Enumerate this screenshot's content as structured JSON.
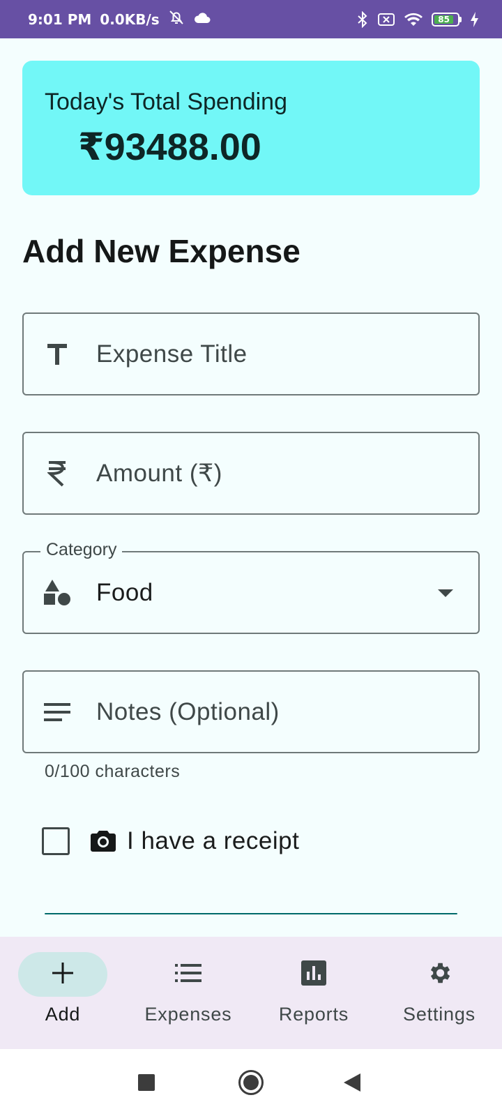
{
  "status_bar": {
    "time": "9:01 PM",
    "network_speed": "0.0KB/s",
    "battery_level": "85",
    "icons": [
      "alarm-off-icon",
      "cloud-icon",
      "bluetooth-icon",
      "no-sim-icon",
      "wifi-icon",
      "battery-icon",
      "charging-icon"
    ]
  },
  "summary": {
    "label": "Today's Total Spending",
    "amount": "₹93488.00"
  },
  "form": {
    "title": "Add New Expense",
    "title_field": {
      "placeholder": "Expense Title",
      "icon": "text-title-icon"
    },
    "amount_field": {
      "placeholder": "Amount (₹)",
      "icon": "rupee-icon"
    },
    "category_field": {
      "label": "Category",
      "value": "Food",
      "icon": "category-shapes-icon"
    },
    "notes_field": {
      "placeholder": "Notes (Optional)",
      "icon": "notes-lines-icon",
      "helper": "0/100 characters"
    },
    "receipt": {
      "label": "I have a receipt",
      "checked": false,
      "icon": "camera-icon"
    }
  },
  "bottom_nav": {
    "items": [
      {
        "label": "Add",
        "icon": "add-icon",
        "active": true
      },
      {
        "label": "Expenses",
        "icon": "list-icon",
        "active": false
      },
      {
        "label": "Reports",
        "icon": "bar-chart-icon",
        "active": false
      },
      {
        "label": "Settings",
        "icon": "gear-icon",
        "active": false
      }
    ]
  },
  "colors": {
    "status_bar": "#6750a4",
    "summary_card": "#72f7f7",
    "background": "#f4fefe",
    "nav_background": "#f0e9f5",
    "active_pill": "#cde8e8",
    "accent": "#006a6a"
  }
}
